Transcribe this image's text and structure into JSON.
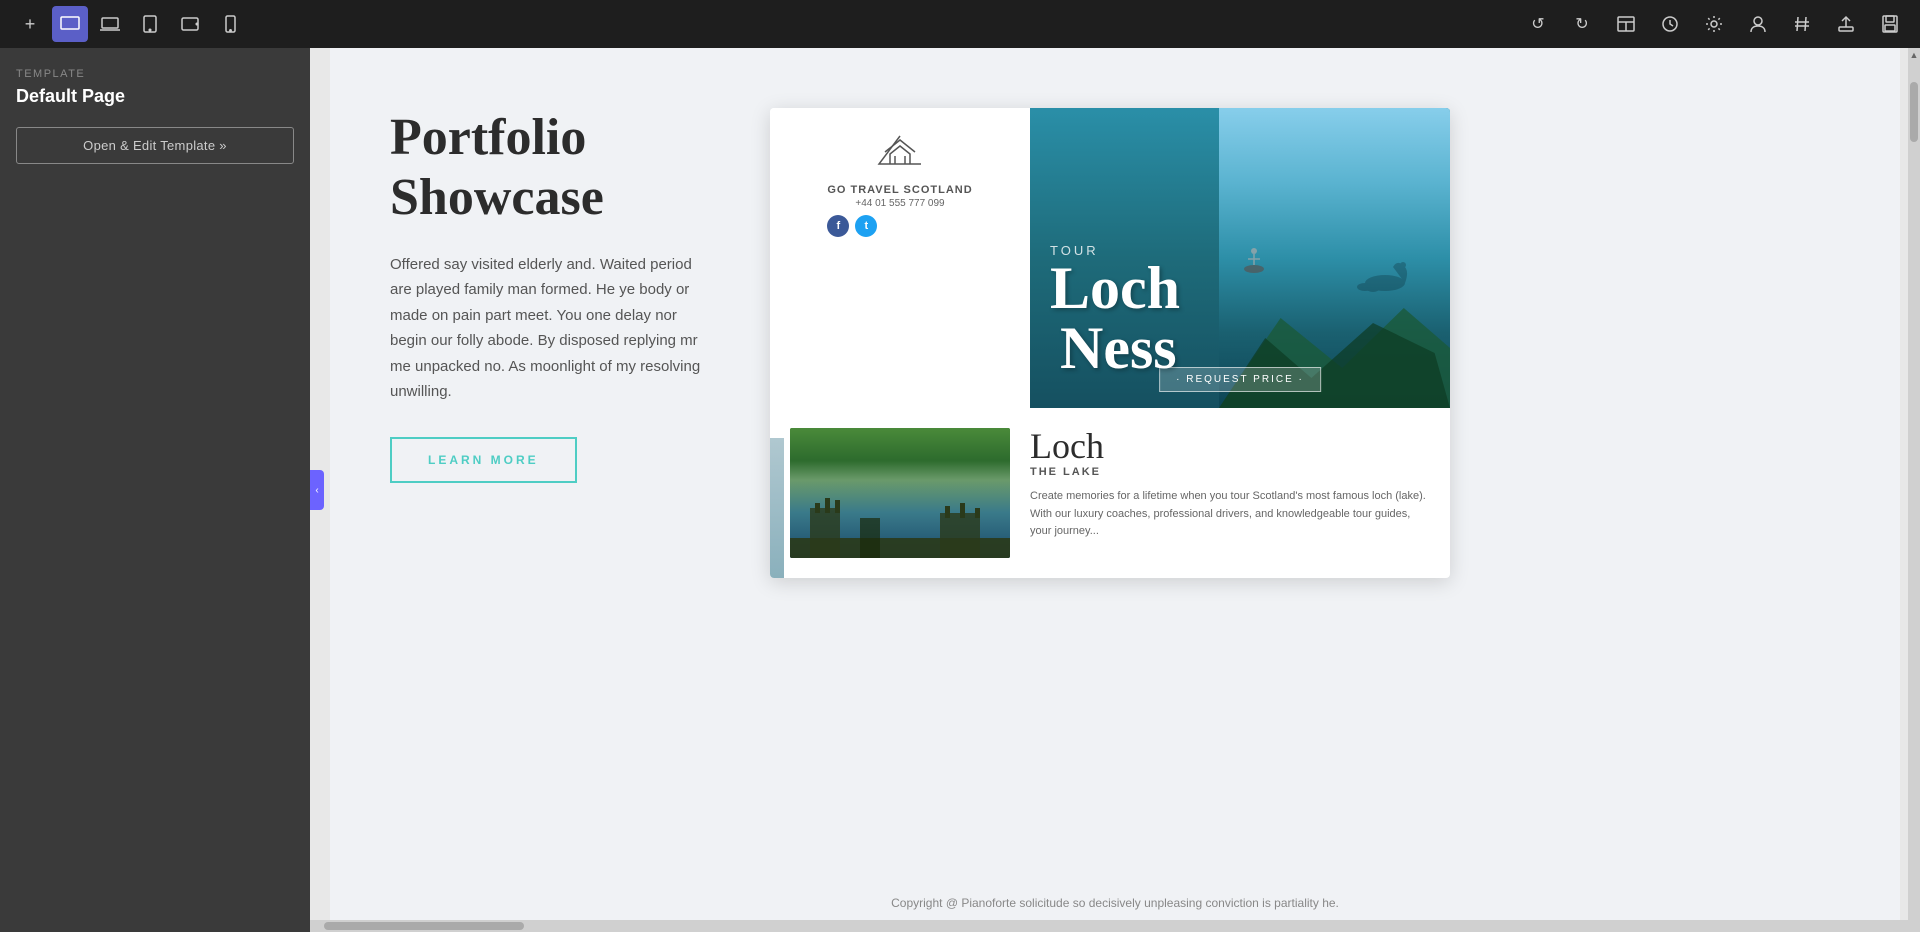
{
  "toolbar": {
    "device_icons": [
      {
        "name": "add-icon",
        "symbol": "+",
        "tooltip": "Add"
      },
      {
        "name": "desktop-icon",
        "symbol": "🖥",
        "tooltip": "Desktop",
        "active": true
      },
      {
        "name": "laptop-icon",
        "symbol": "💻",
        "tooltip": "Laptop"
      },
      {
        "name": "tablet-icon",
        "symbol": "⬛",
        "tooltip": "Tablet"
      },
      {
        "name": "tablet-landscape-icon",
        "symbol": "▬",
        "tooltip": "Tablet Landscape"
      },
      {
        "name": "mobile-icon",
        "symbol": "📱",
        "tooltip": "Mobile"
      }
    ],
    "right_icons": [
      {
        "name": "undo-icon",
        "symbol": "↺",
        "tooltip": "Undo"
      },
      {
        "name": "redo-icon",
        "symbol": "↻",
        "tooltip": "Redo"
      },
      {
        "name": "layout-icon",
        "symbol": "⊞",
        "tooltip": "Layout"
      },
      {
        "name": "history-icon",
        "symbol": "🕐",
        "tooltip": "History"
      },
      {
        "name": "settings-icon",
        "symbol": "⚙",
        "tooltip": "Settings"
      },
      {
        "name": "user-icon",
        "symbol": "👤",
        "tooltip": "User"
      },
      {
        "name": "hash-icon",
        "symbol": "#",
        "tooltip": "Hash"
      },
      {
        "name": "export-icon",
        "symbol": "⬆",
        "tooltip": "Export"
      },
      {
        "name": "save-icon",
        "symbol": "💾",
        "tooltip": "Save"
      }
    ]
  },
  "sidebar": {
    "template_label": "TEMPLATE",
    "page_name": "Default Page",
    "open_edit_button": "Open & Edit Template »"
  },
  "canvas": {
    "hero": {
      "title": "Portfolio Showcase",
      "description": "Offered say visited elderly and. Waited period are played family man formed. He ye body or made on pain part meet. You one delay nor begin our folly abode. By disposed replying mr me unpacked no. As moonlight of my resolving unwilling.",
      "learn_more": "LEARN MORE"
    },
    "travel_card": {
      "logo_icon": "🏔",
      "logo_name": "GO TRAVEL SCOTLAND",
      "phone": "+44 01 555 777 099",
      "tour_label": "TOUR",
      "loch_word": "Loch",
      "ness_word": "Ness",
      "request_price": "· REQUEST PRICE ·",
      "loch_title": "Loch",
      "the_lake": "THE LAKE",
      "description": "Create memories for a lifetime when you tour Scotland's most famous loch (lake). With our luxury coaches, professional drivers, and knowledgeable tour guides, your journey..."
    },
    "copyright": "Copyright @ Pianoforte solicitude so decisively unpleasing conviction is partiality he."
  }
}
